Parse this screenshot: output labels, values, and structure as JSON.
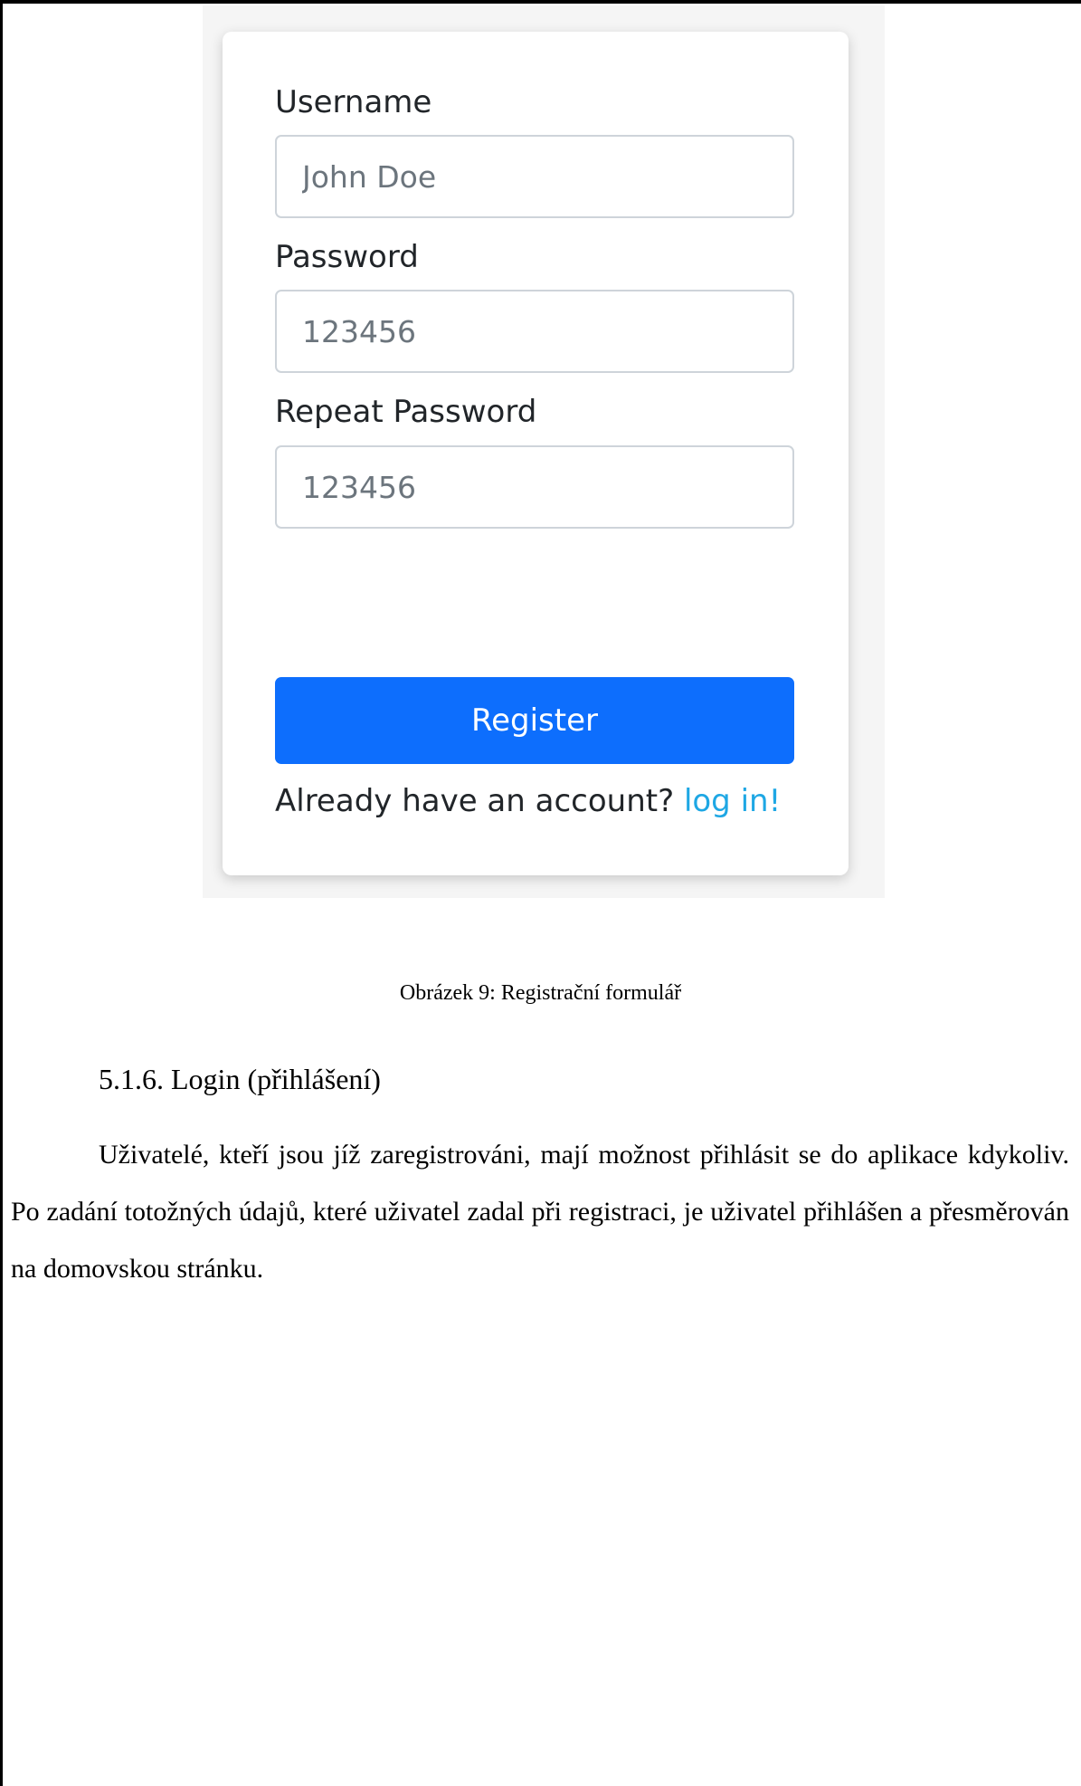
{
  "form": {
    "username_label": "Username",
    "username_placeholder": "John Doe",
    "password_label": "Password",
    "password_placeholder": "123456",
    "repeat_password_label": "Repeat Password",
    "repeat_password_placeholder": "123456",
    "register_button": "Register",
    "login_prompt": "Already have an account?",
    "login_link": "log in!"
  },
  "document": {
    "caption": "Obrázek 9: Registrační formulář",
    "section_heading": "5.1.6. Login (přihlášení)",
    "paragraph": "Uživatelé, kteří jsou jíž zaregistrováni, mají možnost přihlásit se do aplikace kdykoliv. Po zadání totožných údajů, které uživatel zadal při registraci, je uživatel přihlášen a přesměrován na domovskou stránku."
  },
  "colors": {
    "primary_button": "#0d6efd",
    "link": "#1ea7e4",
    "input_border": "#ced4da"
  }
}
